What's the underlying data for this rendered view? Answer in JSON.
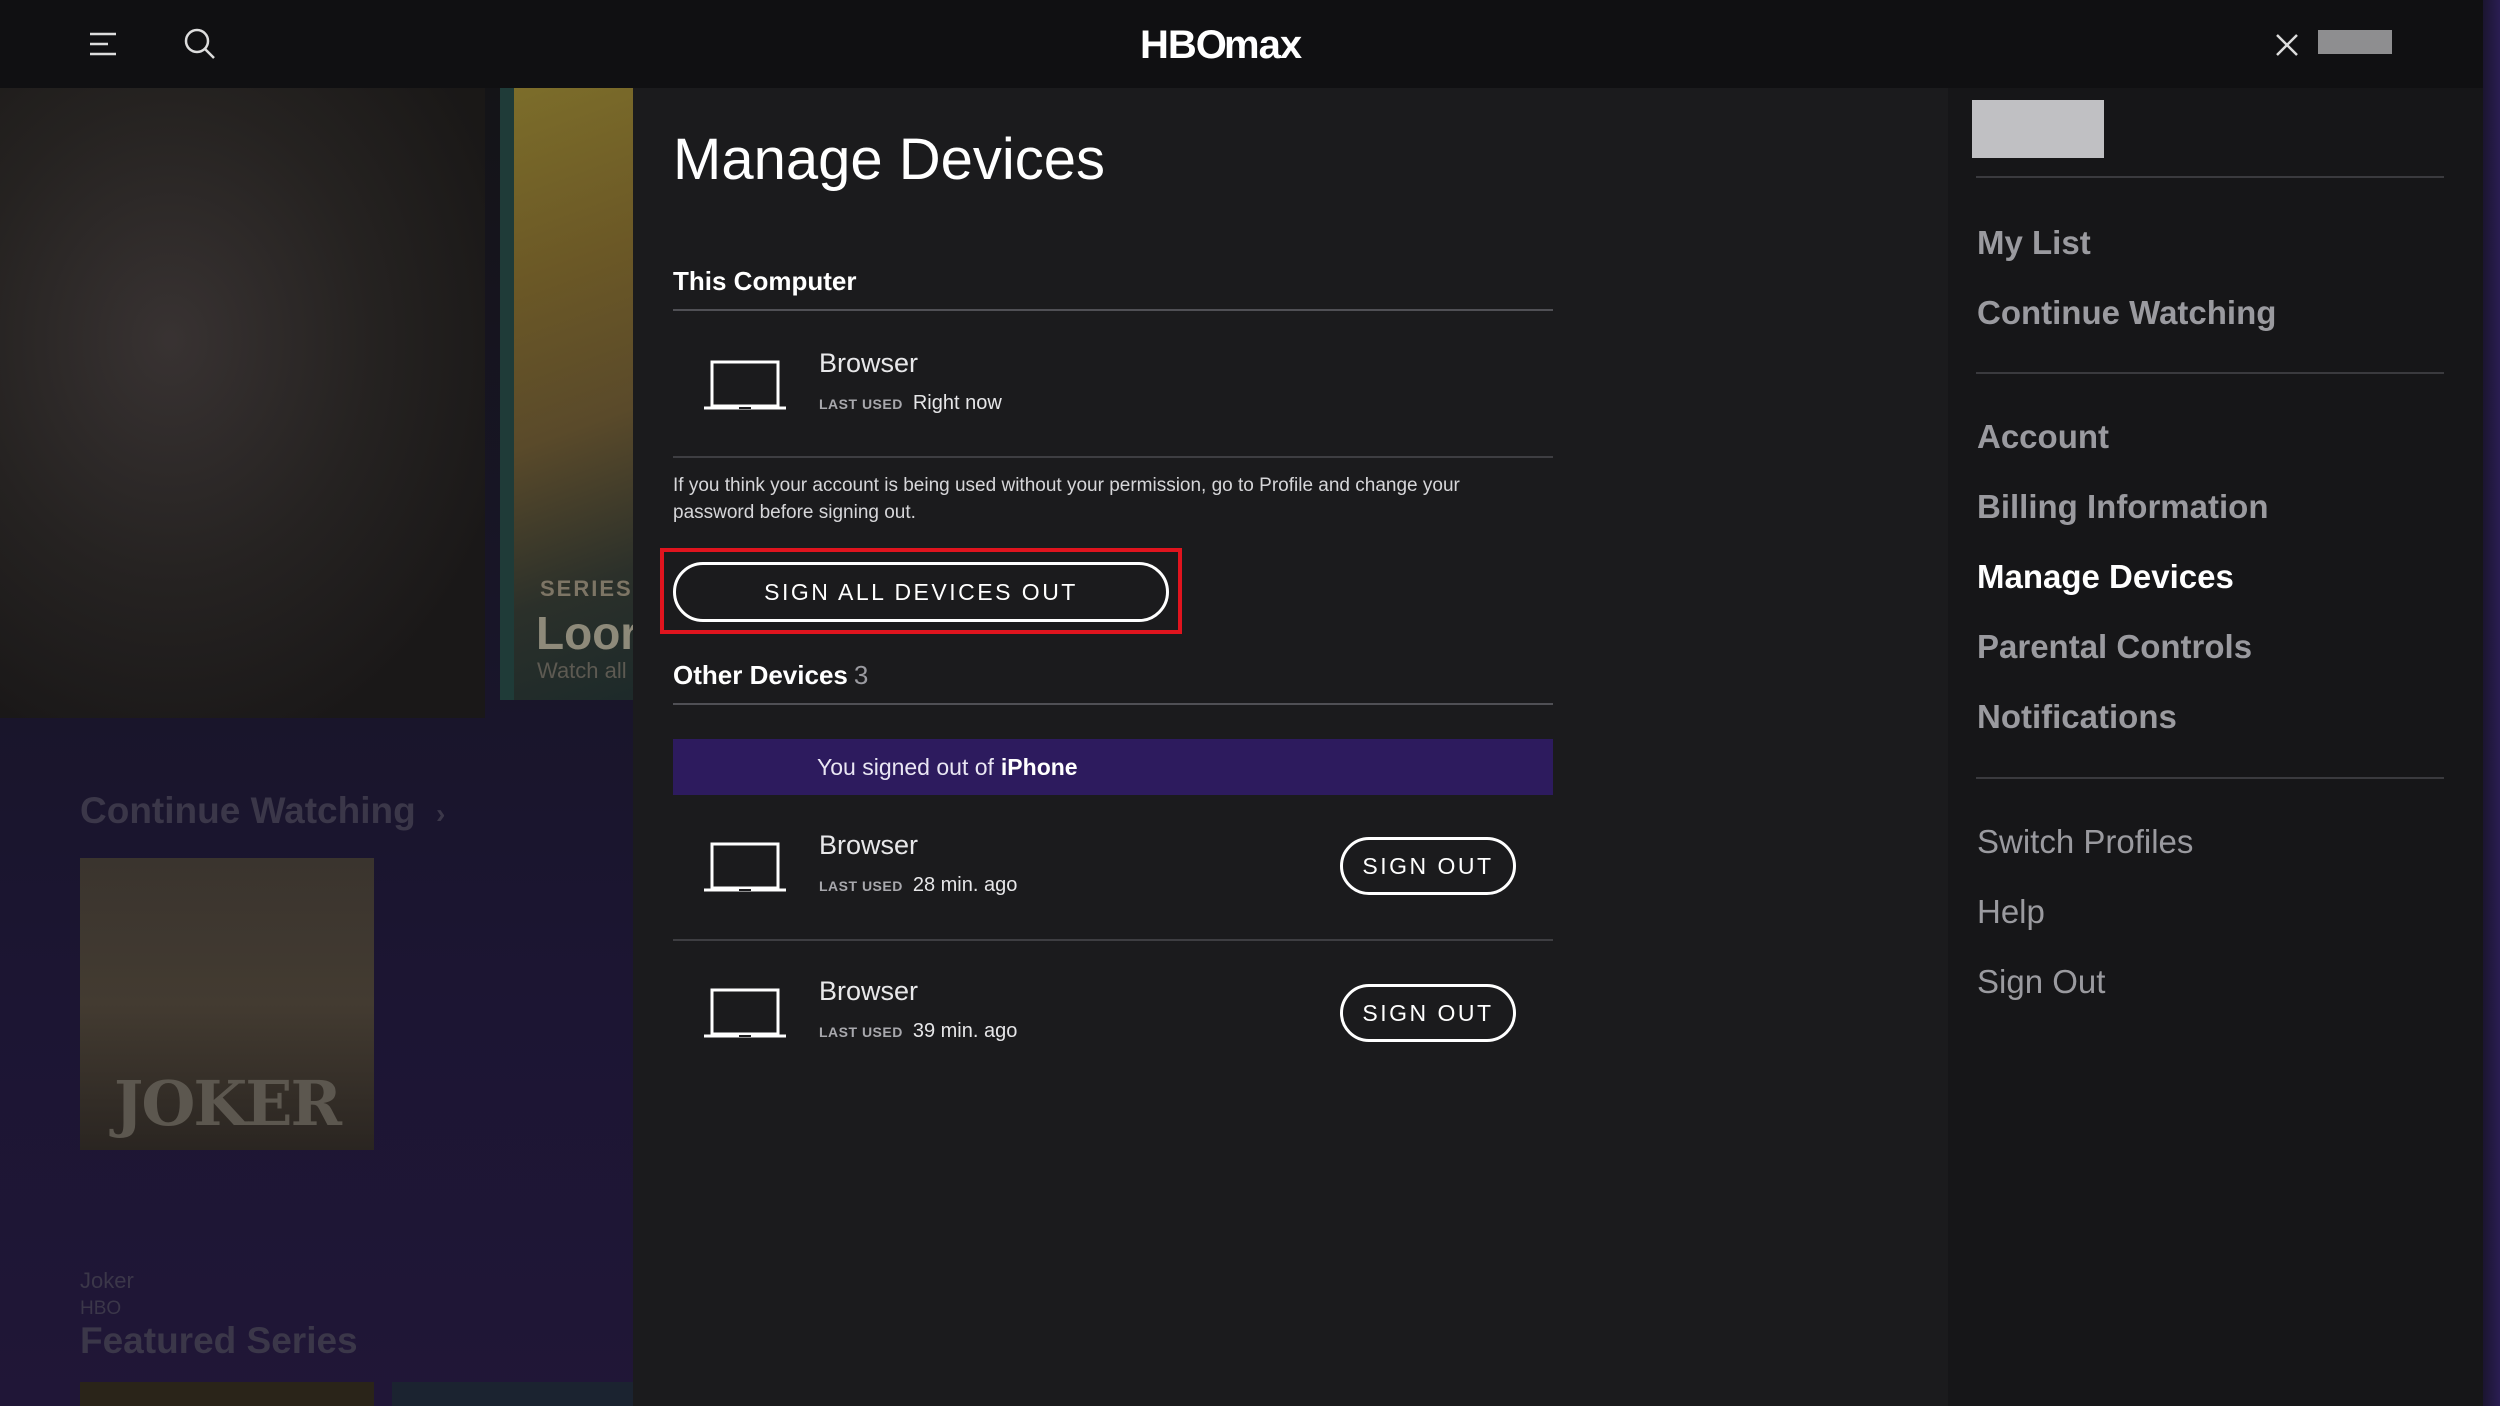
{
  "header": {
    "logo_text": "HBOmax",
    "icons": [
      "menu-icon",
      "search-icon",
      "close-icon"
    ]
  },
  "background": {
    "hero": {
      "series_label": "SERIES",
      "title": "Loor",
      "subtitle": "Watch all"
    },
    "continue_watching": {
      "heading": "Continue Watching",
      "chevron": "›"
    },
    "tile": {
      "poster_text": "JOKER",
      "title": "Joker",
      "network": "HBO"
    },
    "featured_series": {
      "heading": "Featured Series"
    }
  },
  "main": {
    "title": "Manage Devices",
    "this_computer": {
      "heading": "This Computer",
      "device": {
        "name": "Browser",
        "last_used_label": "LAST USED",
        "last_used": "Right now"
      }
    },
    "warning": "If you think your account is being used without your permission, go to Profile and change your password before signing out.",
    "sign_all_label": "SIGN ALL DEVICES OUT",
    "other_devices": {
      "heading": "Other Devices",
      "count": "3",
      "notice_prefix": "You signed out of",
      "notice_device": "iPhone",
      "devices": [
        {
          "name": "Browser",
          "last_used_label": "LAST USED",
          "last_used": "28 min. ago",
          "button": "SIGN OUT"
        },
        {
          "name": "Browser",
          "last_used_label": "LAST USED",
          "last_used": "39 min. ago",
          "button": "SIGN OUT"
        }
      ]
    }
  },
  "sidebar": {
    "group1": [
      "My List",
      "Continue Watching"
    ],
    "group2": [
      "Account",
      "Billing Information",
      "Manage Devices",
      "Parental Controls",
      "Notifications"
    ],
    "group3": [
      "Switch Profiles",
      "Help",
      "Sign Out"
    ],
    "active": "Manage Devices"
  },
  "colors": {
    "accent_purple": "#2d1b5e",
    "highlight_red": "#e0141e",
    "panel_bg": "#1b1b1d",
    "sidebar_bg": "#161618"
  }
}
